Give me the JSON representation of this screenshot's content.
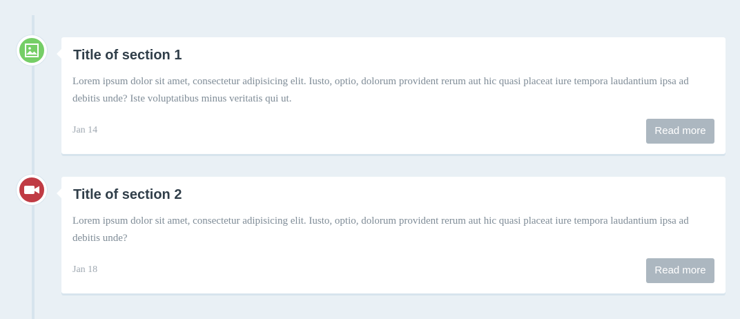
{
  "colors": {
    "background": "#e9f0f5",
    "line": "#d7e4ed",
    "picture_marker": "#75ce66",
    "movie_marker": "#c03b44",
    "button": "#acb7c0",
    "title": "#303e49",
    "text": "#7f8c97"
  },
  "timeline": {
    "items": [
      {
        "icon": "picture-icon",
        "title": "Title of section 1",
        "text": "Lorem ipsum dolor sit amet, consectetur adipisicing elit. Iusto, optio, dolorum provident rerum aut hic quasi placeat iure tempora laudantium ipsa ad debitis unde? Iste voluptatibus minus veritatis qui ut.",
        "date": "Jan 14",
        "button": "Read more"
      },
      {
        "icon": "movie-icon",
        "title": "Title of section 2",
        "text": "Lorem ipsum dolor sit amet, consectetur adipisicing elit. Iusto, optio, dolorum provident rerum aut hic quasi placeat iure tempora laudantium ipsa ad debitis unde?",
        "date": "Jan 18",
        "button": "Read more"
      }
    ]
  }
}
